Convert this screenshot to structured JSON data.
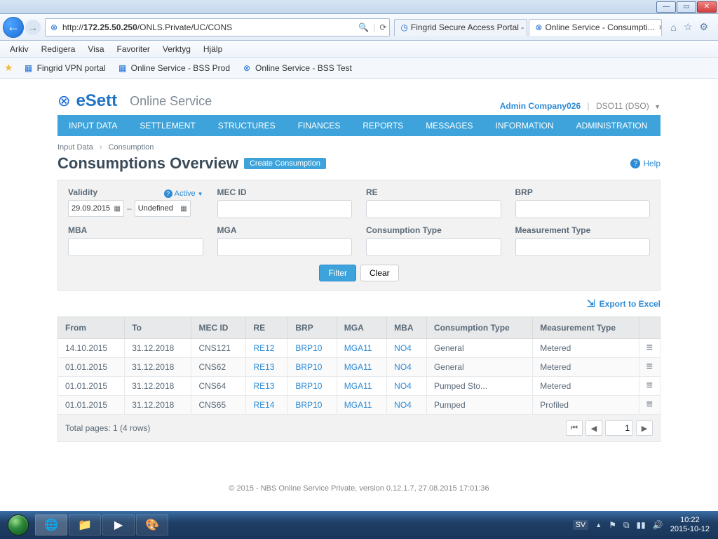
{
  "window": {
    "min": "—",
    "max": "▭",
    "close": "✕"
  },
  "browser": {
    "back": "←",
    "fwd": "→",
    "url_label": "http://",
    "url_host": "172.25.50.250",
    "url_path": "/ONLS.Private/UC/CONS",
    "search_icon": "🔍",
    "refresh": "⟳",
    "tabs": [
      {
        "label": "Fingrid Secure Access Portal - ..."
      },
      {
        "label": "Online Service - Consumpti...",
        "active": true
      }
    ],
    "tool_home": "⌂",
    "tool_star": "☆",
    "tool_gear": "⚙",
    "menu": [
      "Arkiv",
      "Redigera",
      "Visa",
      "Favoriter",
      "Verktyg",
      "Hjälp"
    ],
    "fav_star": "★",
    "favorites": [
      {
        "label": "Fingrid VPN portal"
      },
      {
        "label": "Online Service - BSS Prod"
      },
      {
        "label": "Online Service - BSS Test"
      }
    ]
  },
  "brand": {
    "name": "eSett",
    "sub": "Online Service"
  },
  "user": {
    "admin": "Admin Company026",
    "dso": "DSO11 (DSO)"
  },
  "nav": [
    "INPUT DATA",
    "SETTLEMENT",
    "STRUCTURES",
    "FINANCES",
    "REPORTS",
    "MESSAGES",
    "INFORMATION",
    "ADMINISTRATION"
  ],
  "crumbs": {
    "a": "Input Data",
    "b": "Consumption"
  },
  "title": "Consumptions Overview",
  "create_btn": "Create Consumption",
  "help": "Help",
  "filters": {
    "validity_label": "Validity",
    "active_label": "Active",
    "date_from": "29.09.2015",
    "date_to": "Undefined",
    "mec_label": "MEC ID",
    "re_label": "RE",
    "brp_label": "BRP",
    "mba_label": "MBA",
    "mga_label": "MGA",
    "ctype_label": "Consumption Type",
    "mtype_label": "Measurement Type",
    "filter_btn": "Filter",
    "clear_btn": "Clear"
  },
  "export_label": "Export to Excel",
  "table": {
    "headers": {
      "from": "From",
      "to": "To",
      "mec": "MEC ID",
      "re": "RE",
      "brp": "BRP",
      "mga": "MGA",
      "mba": "MBA",
      "ctype": "Consumption Type",
      "mtype": "Measurement Type"
    },
    "rows": [
      {
        "from": "14.10.2015",
        "to": "31.12.2018",
        "mec": "CNS121",
        "re": "RE12",
        "brp": "BRP10",
        "mga": "MGA11",
        "mba": "NO4",
        "ctype": "General",
        "mtype": "Metered"
      },
      {
        "from": "01.01.2015",
        "to": "31.12.2018",
        "mec": "CNS62",
        "re": "RE13",
        "brp": "BRP10",
        "mga": "MGA11",
        "mba": "NO4",
        "ctype": "General",
        "mtype": "Metered"
      },
      {
        "from": "01.01.2015",
        "to": "31.12.2018",
        "mec": "CNS64",
        "re": "RE13",
        "brp": "BRP10",
        "mga": "MGA11",
        "mba": "NO4",
        "ctype": "Pumped Sto...",
        "mtype": "Metered"
      },
      {
        "from": "01.01.2015",
        "to": "31.12.2018",
        "mec": "CNS65",
        "re": "RE14",
        "brp": "BRP10",
        "mga": "MGA11",
        "mba": "NO4",
        "ctype": "Pumped",
        "mtype": "Profiled"
      }
    ]
  },
  "pager": {
    "summary": "Total pages: 1 (4 rows)",
    "first": "⏮",
    "prev": "◀",
    "page": "1",
    "next": "▶"
  },
  "footer": "© 2015 - NBS Online Service Private, version 0.12.1.7, 27.08.2015 17:01:36",
  "taskbar": {
    "lang": "SV",
    "up": "▲",
    "time": "10:22",
    "date": "2015-10-12"
  }
}
